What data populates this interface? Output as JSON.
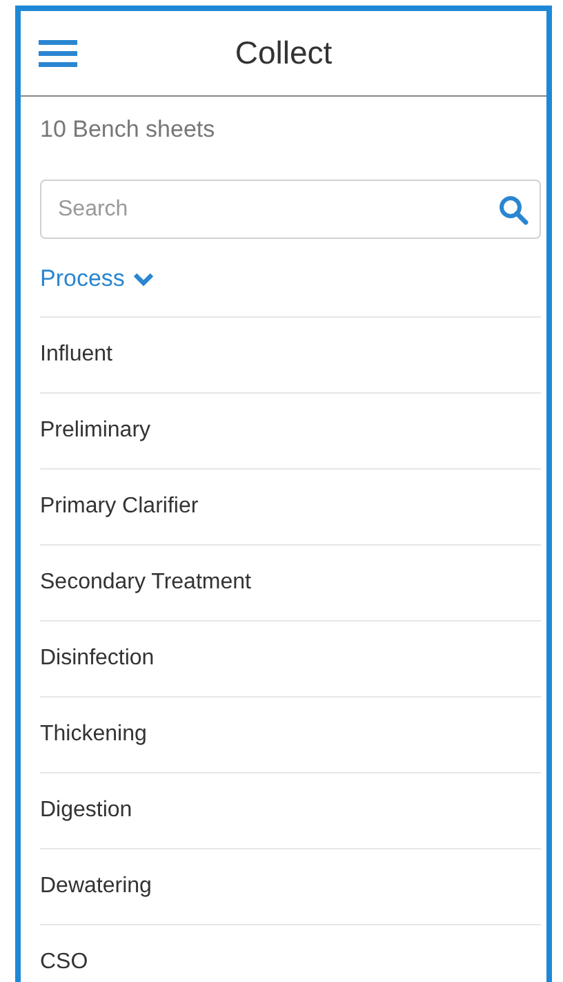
{
  "header": {
    "title": "Collect"
  },
  "count": "10 Bench sheets",
  "search": {
    "placeholder": "Search"
  },
  "filter": {
    "label": "Process",
    "expanded": true
  },
  "items": [
    "Influent",
    "Preliminary",
    "Primary Clarifier",
    "Secondary Treatment",
    "Disinfection",
    "Thickening",
    "Digestion",
    "Dewatering",
    "CSO"
  ]
}
